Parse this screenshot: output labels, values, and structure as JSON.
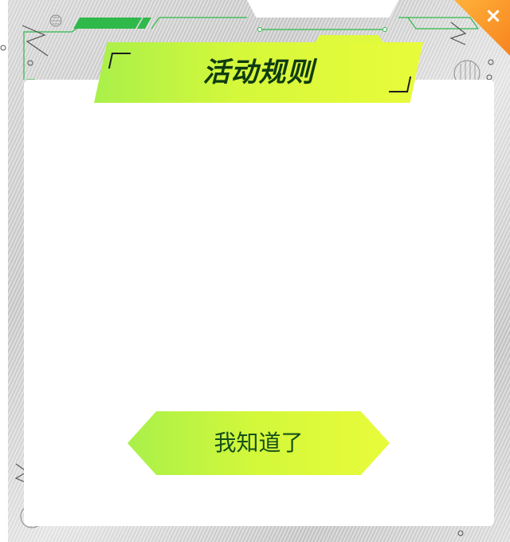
{
  "dialog": {
    "title": "活动规则",
    "close_glyph": "×",
    "rules_text": "",
    "confirm_label": "我知道了"
  },
  "icons": {
    "close": "close-icon"
  },
  "colors": {
    "accent_green_start": "#a9f04a",
    "accent_green_end": "#e8fb3a",
    "title_text": "#0f3b12",
    "button_text": "#14501a",
    "close_orange": "#f7841f",
    "deco_line": "#2fb94a"
  }
}
